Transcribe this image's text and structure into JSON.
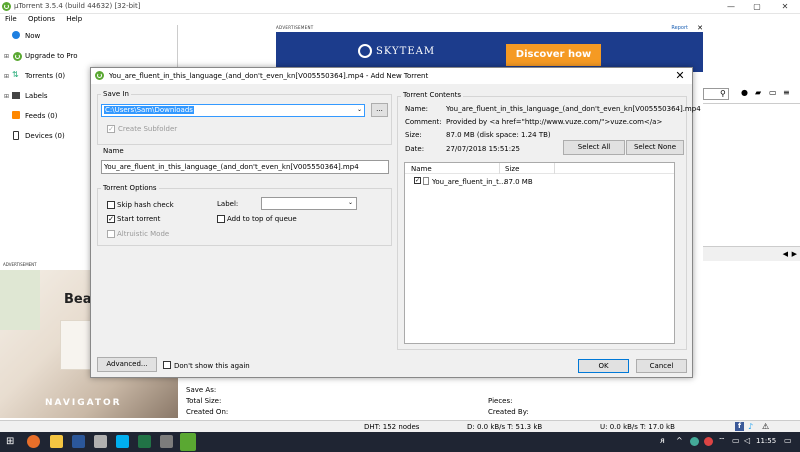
{
  "window": {
    "title": "µTorrent 3.5.4  (build 44632) [32-bit]",
    "minimize": "—",
    "maximize": "▢",
    "close": "✕"
  },
  "menu": [
    "File",
    "Options",
    "Help"
  ],
  "sidebar": {
    "items": [
      {
        "label": "Now",
        "icon": "blue-dot-icon"
      },
      {
        "label": "Upgrade to Pro",
        "icon": "utorrent-logo-icon"
      },
      {
        "label": "Torrents (0)",
        "icon": "torrents-icon"
      },
      {
        "label": "Labels",
        "icon": "labels-icon"
      },
      {
        "label": "Feeds (0)",
        "icon": "rss-icon"
      },
      {
        "label": "Devices (0)",
        "icon": "device-icon"
      }
    ]
  },
  "ad_top": {
    "label": "ADVERTISEMENT",
    "report": "Report",
    "brand": "SKYTEAM",
    "cta": "Discover how",
    "close": "✕"
  },
  "ad_left": {
    "label": "ADVERTISEMENT",
    "headline": "Bea",
    "brand": "NAVIGATOR"
  },
  "dialog": {
    "title": "You_are_fluent_in_this_language_(and_don't_even_kn[V005550364].mp4 - Add New Torrent",
    "close": "✕",
    "save_in": {
      "label": "Save In",
      "value": "C:\\Users\\Sam\\Downloads",
      "browse": "...",
      "create_subfolder": "Create Subfolder"
    },
    "name": {
      "label": "Name",
      "value": "You_are_fluent_in_this_language_(and_don't_even_kn[V005550364].mp4"
    },
    "options": {
      "label": "Torrent Options",
      "skip_hash": "Skip hash check",
      "start_torrent": "Start torrent",
      "altruistic": "Altruistic Mode",
      "label_field": "Label:",
      "add_top": "Add to top of queue"
    },
    "contents": {
      "label": "Torrent Contents",
      "name_k": "Name:",
      "name_v": "You_are_fluent_in_this_language_(and_don't_even_kn[V005550364].mp4",
      "comment_k": "Comment:",
      "comment_v": "Provided by <a href=\"http://www.vuze.com/\">vuze.com</a>",
      "size_k": "Size:",
      "size_v": "87.0 MB (disk space: 1.24 TB)",
      "date_k": "Date:",
      "date_v": "27/07/2018 15:51:25",
      "select_all": "Select All",
      "select_none": "Select None",
      "col_name": "Name",
      "col_size": "Size",
      "files": [
        {
          "name": "You_are_fluent_in_t...",
          "size": "87.0 MB"
        }
      ]
    },
    "advanced": "Advanced...",
    "dont_show": "Don't show this again",
    "ok": "OK",
    "cancel": "Cancel"
  },
  "bottom": {
    "save_as": "Save As:",
    "total_size": "Total Size:",
    "created_on": "Created On:",
    "pieces": "Pieces:",
    "created_by": "Created By:"
  },
  "status": {
    "dht": "DHT: 152 nodes",
    "down": "D: 0.0 kB/s T: 51.3 kB",
    "up": "U: 0.0 kB/s T: 17.0 kB"
  },
  "taskbar": {
    "time": "11:55"
  }
}
